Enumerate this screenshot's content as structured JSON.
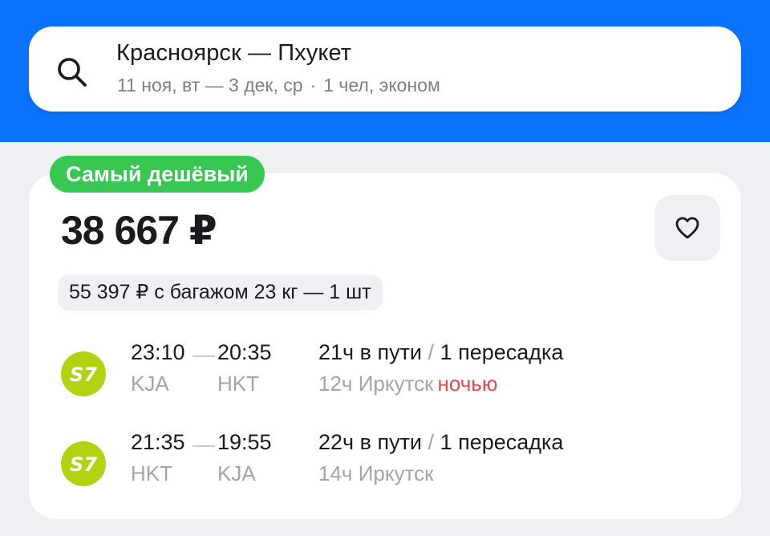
{
  "search": {
    "route": "Красноярск — Пхукет",
    "dates": "11 ноя, вт — 3 дек, ср",
    "separator": "·",
    "passengers": "1 чел, эконом"
  },
  "offer": {
    "badge": "Самый дешёвый",
    "price": "38 667 ₽",
    "baggage_option": "55 397 ₽ с багажом 23 кг — 1 шт",
    "favorite_icon": "heart-icon"
  },
  "segments": [
    {
      "airline_logo": "s7-logo",
      "airline_logo_text": "S7",
      "depart_time": "23:10",
      "arrive_time": "20:35",
      "from_code": "KJA",
      "to_code": "HKT",
      "duration": "21ч в пути",
      "slash": "/",
      "transfers": "1 пересадка",
      "stopover": "12ч Иркутск",
      "stopover_note": "ночью"
    },
    {
      "airline_logo": "s7-logo",
      "airline_logo_text": "S7",
      "depart_time": "21:35",
      "arrive_time": "19:55",
      "from_code": "HKT",
      "to_code": "KJA",
      "duration": "22ч в пути",
      "slash": "/",
      "transfers": "1 пересадка",
      "stopover": "14ч Иркутск",
      "stopover_note": ""
    }
  ],
  "colors": {
    "header_blue": "#0c73fe",
    "badge_green": "#37c752",
    "s7_green": "#b2d313",
    "night_red": "#e5484d"
  }
}
